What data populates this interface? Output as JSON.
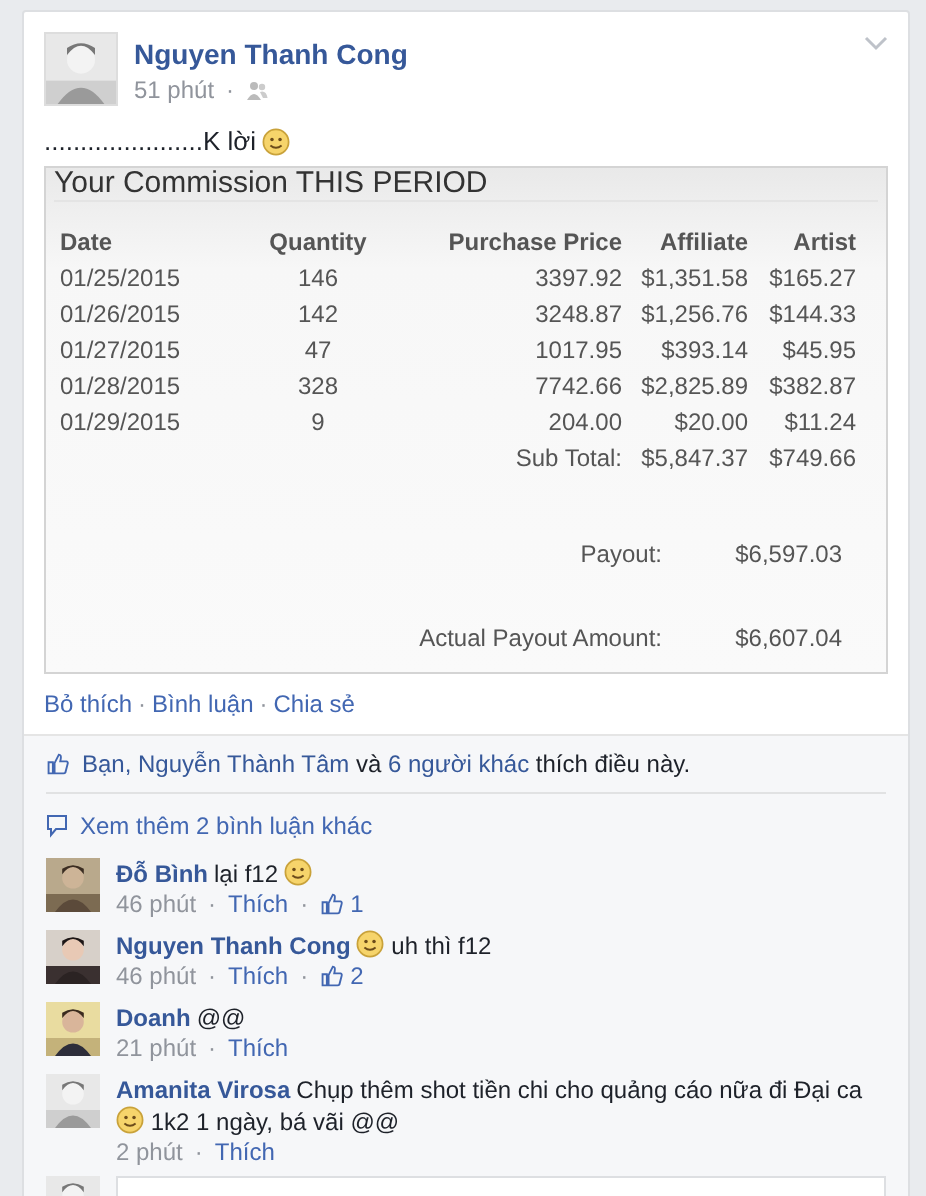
{
  "post": {
    "author": "Nguyen Thanh Cong",
    "time": "51 phút",
    "text": "......................K lời",
    "text_emoji": true,
    "image": {
      "title": "Your Commission THIS PERIOD",
      "columns": [
        "Date",
        "Quantity",
        "Purchase Price",
        "Affiliate",
        "Artist"
      ],
      "rows": [
        [
          "01/25/2015",
          "146",
          "3397.92",
          "$1,351.58",
          "$165.27"
        ],
        [
          "01/26/2015",
          "142",
          "3248.87",
          "$1,256.76",
          "$144.33"
        ],
        [
          "01/27/2015",
          "47",
          "1017.95",
          "$393.14",
          "$45.95"
        ],
        [
          "01/28/2015",
          "328",
          "7742.66",
          "$2,825.89",
          "$382.87"
        ],
        [
          "01/29/2015",
          "9",
          "204.00",
          "$20.00",
          "$11.24"
        ]
      ],
      "subtotal": {
        "label": "Sub Total:",
        "affiliate": "$5,847.37",
        "artist": "$749.66"
      },
      "totals": [
        {
          "label": "Payout:",
          "value": "$6,597.03"
        },
        {
          "label": "Actual Payout Amount:",
          "value": "$6,607.04"
        }
      ]
    },
    "actions": [
      {
        "text": "Bỏ thích"
      },
      {
        "separator": "·",
        "text": "Bình luận"
      },
      {
        "separator": "·",
        "text": "Chia sẻ"
      }
    ],
    "time_separator": "·"
  },
  "likes": {
    "parts": [
      {
        "kind": "link",
        "text": "Bạn, Nguyễn Thành Tâm"
      },
      {
        "kind": "text",
        "text": " và "
      },
      {
        "kind": "link",
        "text": "6 người khác"
      },
      {
        "kind": "text",
        "text": " thích điều này."
      }
    ]
  },
  "more_comments": "Xem thêm 2 bình luận khác",
  "comments": [
    {
      "author": "Đỗ Bình",
      "body": [
        {
          "kind": "text",
          "text": "lại f12"
        },
        {
          "kind": "emoji"
        }
      ],
      "time": "46 phút",
      "time_separator": "·",
      "like": "Thích",
      "likes_separator": "·",
      "likes": "1"
    },
    {
      "author": "Nguyen Thanh Cong",
      "body": [
        {
          "kind": "emoji"
        },
        {
          "kind": "text",
          "text": "uh thì f12"
        }
      ],
      "time": "46 phút",
      "time_separator": "·",
      "like": "Thích",
      "likes_separator": "·",
      "likes": "2"
    },
    {
      "author": "Doanh",
      "body": [
        {
          "kind": "text",
          "text": "@@"
        }
      ],
      "time": "21 phút",
      "time_separator": "·",
      "like": "Thích"
    },
    {
      "author": "Amanita Virosa",
      "body": [
        {
          "kind": "text",
          "text": "Chụp thêm shot tiền chi cho quảng cáo nữa đi Đại ca"
        },
        {
          "kind": "emoji"
        },
        {
          "kind": "text",
          "text": "1k2 1 ngày, bá vãi @@"
        }
      ],
      "time": "2 phút",
      "time_separator": "·",
      "like": "Thích"
    }
  ]
}
